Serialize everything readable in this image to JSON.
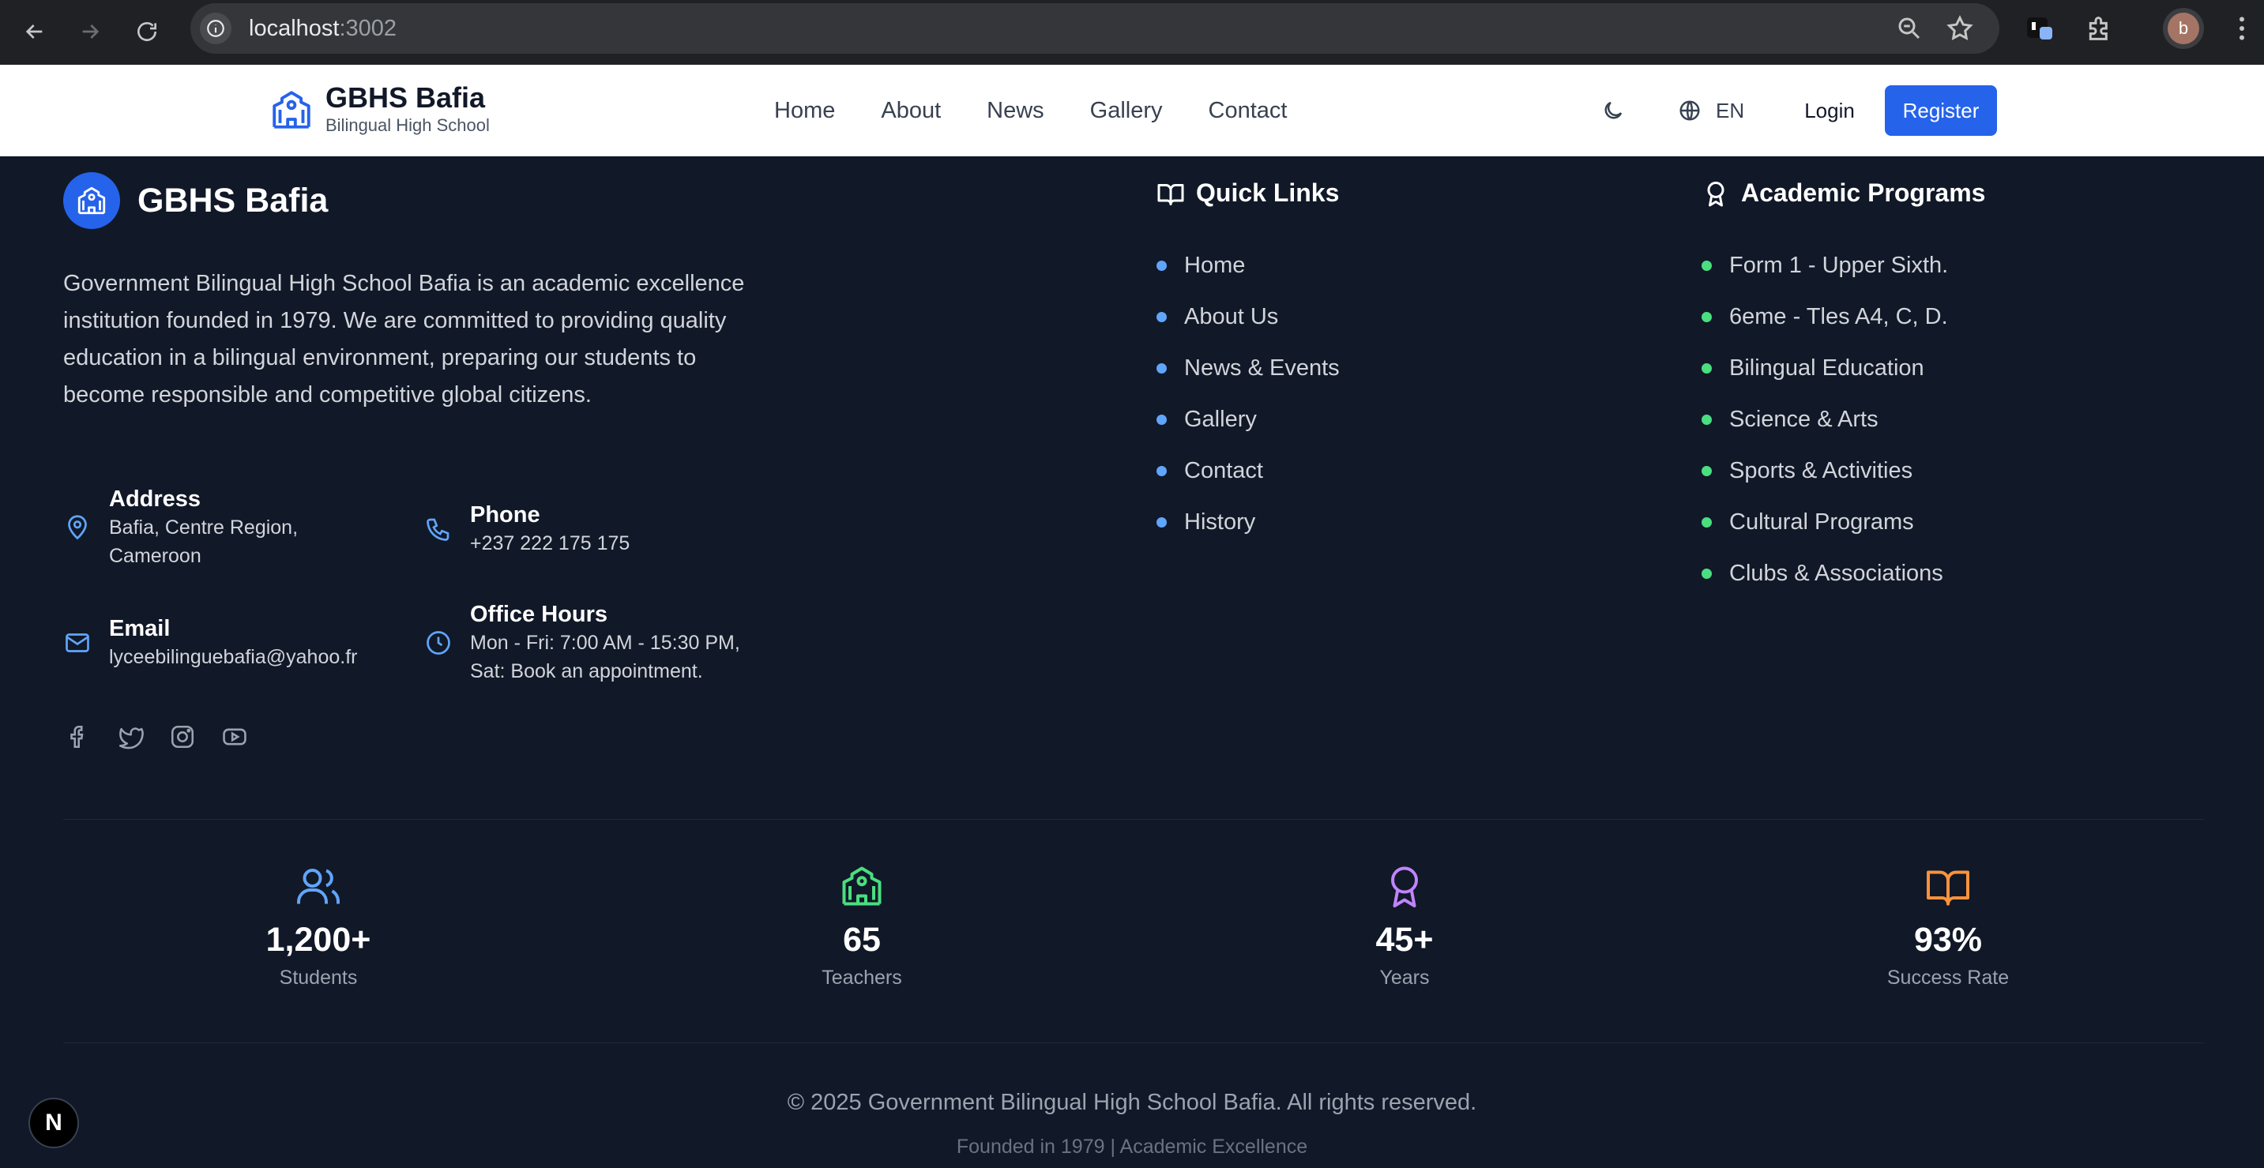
{
  "browser": {
    "url_host": "localhost",
    "url_port": ":3002",
    "profile_initial": "b"
  },
  "header": {
    "brand_title": "GBHS Bafia",
    "brand_subtitle": "Bilingual High School",
    "nav": [
      "Home",
      "About",
      "News",
      "Gallery",
      "Contact"
    ],
    "lang": "EN",
    "login": "Login",
    "register": "Register"
  },
  "footer": {
    "brand_title": "GBHS Bafia",
    "about": "Government Bilingual High School Bafia is an academic excellence institution founded in 1979. We are committed to providing quality education in a bilingual environment, preparing our students to become responsible and competitive global citizens.",
    "contacts": {
      "address_title": "Address",
      "address_line1": "Bafia, Centre Region,",
      "address_line2": "Cameroon",
      "phone_title": "Phone",
      "phone": "+237 222 175 175",
      "email_title": "Email",
      "email": "lyceebilinguebafia@yahoo.fr",
      "hours_title": "Office Hours",
      "hours_line1": "Mon - Fri: 7:00 AM - 15:30 PM,",
      "hours_line2": "Sat: Book an appointment."
    },
    "quick_links_title": "Quick Links",
    "quick_links": [
      "Home",
      "About Us",
      "News & Events",
      "Gallery",
      "Contact",
      "History"
    ],
    "programs_title": "Academic Programs",
    "programs": [
      "Form 1 - Upper Sixth.",
      "6eme - Tles A4, C, D.",
      "Bilingual Education",
      "Science & Arts",
      "Sports & Activities",
      "Cultural Programs",
      "Clubs & Associations"
    ],
    "stats": [
      {
        "value": "1,200+",
        "label": "Students"
      },
      {
        "value": "65",
        "label": "Teachers"
      },
      {
        "value": "45+",
        "label": "Years"
      },
      {
        "value": "93%",
        "label": "Success Rate"
      }
    ],
    "copyright": "© 2025 Government Bilingual High School Bafia. All rights reserved.",
    "founded": "Founded in 1979 | Academic Excellence"
  },
  "colors": {
    "primary": "#2563eb",
    "link_dot": "#60a5fa",
    "program_dot": "#4ade80",
    "stat_blue": "#60a5fa",
    "stat_green": "#4ade80",
    "stat_purple": "#c084fc",
    "stat_orange": "#fb923c"
  }
}
